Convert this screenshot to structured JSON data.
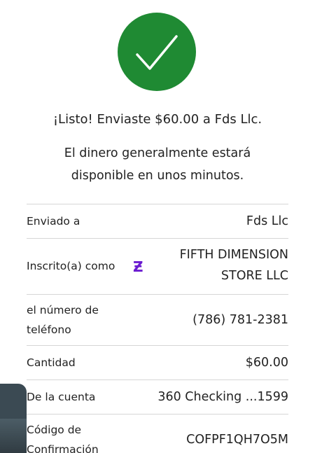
{
  "confirmation": {
    "headline": "¡Listo! Enviaste $60.00 a Fds Llc.",
    "subline_1": "El dinero generalmente estará",
    "subline_2": "disponible en unos minutos."
  },
  "icons": {
    "success": "checkmark-icon",
    "zelle": "zelle-logo-icon",
    "zelle_glyph": "Ƶ"
  },
  "colors": {
    "success_green": "#1f8a33",
    "zelle_purple": "#6a1bd0",
    "divider": "#d6d6d6"
  },
  "details": {
    "sent_to": {
      "label": "Enviado a",
      "value": "Fds Llc"
    },
    "enrolled_as": {
      "label": "Inscrito(a) como",
      "value_1": "FIFTH DIMENSION",
      "value_2": "STORE LLC"
    },
    "phone": {
      "label_1": "el número de",
      "label_2": "teléfono",
      "value": "(786) 781-2381"
    },
    "amount": {
      "label": "Cantidad",
      "value": "$60.00"
    },
    "from_account": {
      "label": "De la cuenta",
      "value": "360 Checking ...1599"
    },
    "confirmation_code": {
      "label_1": "Código de",
      "label_2": "Confirmación",
      "value": "COFPF1QH7O5M"
    }
  }
}
